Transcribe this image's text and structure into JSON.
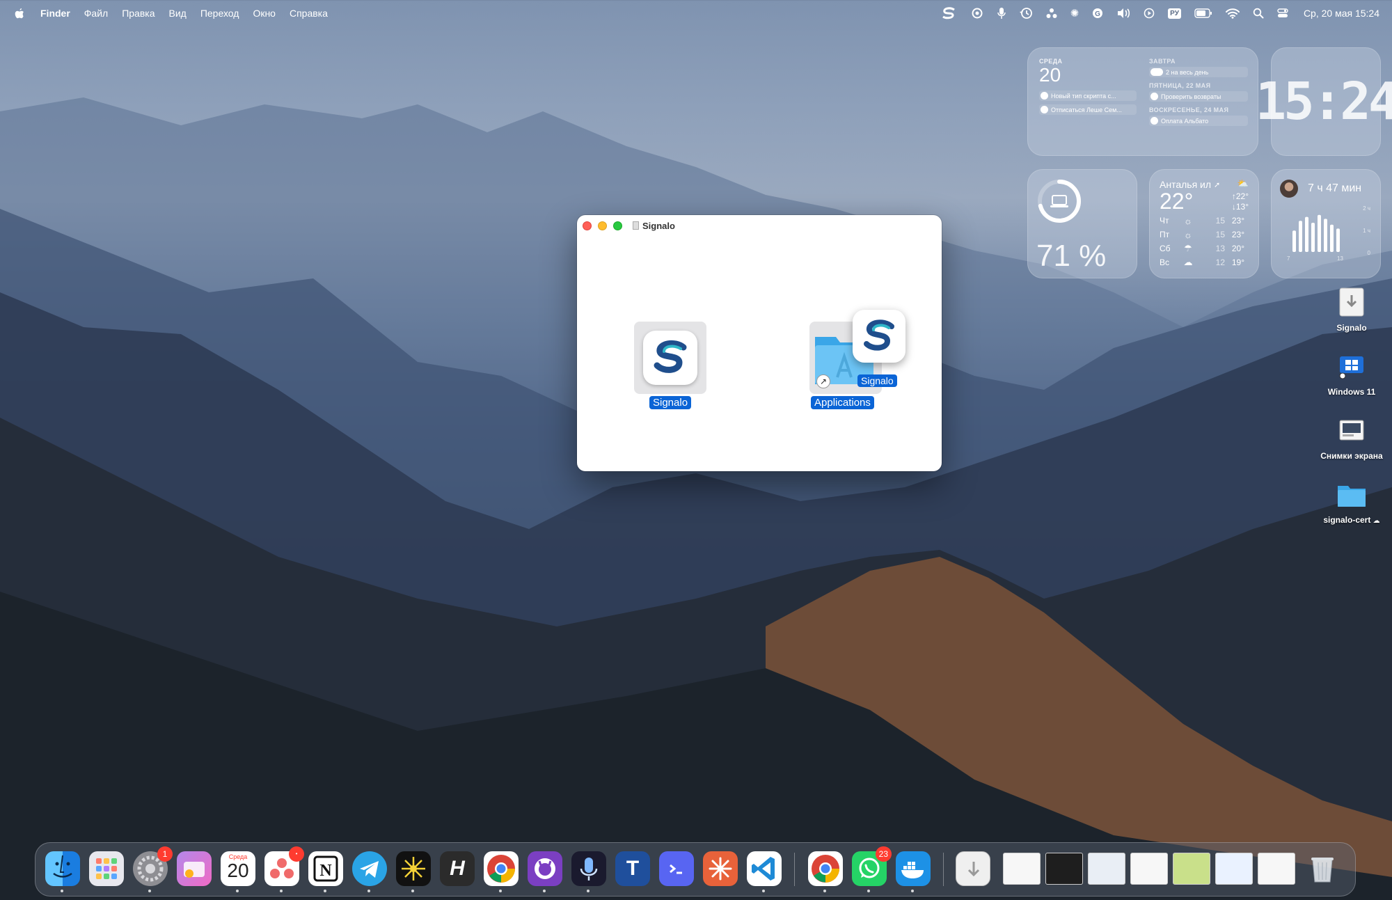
{
  "menubar": {
    "apple": "apple-icon",
    "app_name": "Finder",
    "menus": [
      "Файл",
      "Правка",
      "Вид",
      "Переход",
      "Окно",
      "Справка"
    ],
    "status_icons": [
      "signalo-icon",
      "creative-cloud-icon",
      "microphone-icon",
      "time-machine-icon",
      "connections-icon",
      "brightness-icon",
      "grammarly-icon",
      "volume-icon",
      "play-icon",
      "battery-icon",
      "wifi-icon",
      "search-icon",
      "control-center-icon"
    ],
    "keyboard_layout": "РУ",
    "datetime": "Ср, 20 мая  15:24"
  },
  "widgets": {
    "calendar": {
      "today_label": "СРЕДА",
      "today_day": "20",
      "today_events": [
        "Новый тип скрипта с...",
        "Отписаться Леше Сем..."
      ],
      "tomorrow_label": "ЗАВТРА",
      "tomorrow_event": "2 на весь день",
      "friday_label": "ПЯТНИЦА, 22 МАЯ",
      "friday_event": "Проверить возвраты",
      "sunday_label": "ВОСКРЕСЕНЬЕ, 24 МАЯ",
      "sunday_event": "Оплата Альбато"
    },
    "clock": {
      "time": "15:24"
    },
    "battery": {
      "percent": "71 %",
      "level": 0.71
    },
    "weather": {
      "city": "Анталья ил",
      "temp": "22°",
      "high": "↑22°",
      "low": "↓13°",
      "forecast": [
        {
          "day": "Чт",
          "icon": "sun-icon",
          "lo": "15",
          "hi": "23°"
        },
        {
          "day": "Пт",
          "icon": "sun-icon",
          "lo": "15",
          "hi": "23°"
        },
        {
          "day": "Сб",
          "icon": "rain-icon",
          "lo": "13",
          "hi": "20°"
        },
        {
          "day": "Вс",
          "icon": "cloud-icon",
          "lo": "12",
          "hi": "19°"
        }
      ]
    },
    "screentime": {
      "duration": "7 ч 47 мин",
      "scale": [
        "2 ч",
        "1 ч",
        "0"
      ],
      "x_labels": [
        "7",
        "13"
      ],
      "bars": [
        0.55,
        0.8,
        0.9,
        0.75,
        0.95,
        0.85,
        0.7,
        0.6
      ]
    }
  },
  "desktop": {
    "icons": [
      {
        "label": "Signalo",
        "icon": "disk-image-icon"
      },
      {
        "label": "Windows 11",
        "icon": "parallels-vm-icon"
      },
      {
        "label": "Снимки экрана",
        "icon": "screenshots-folder-icon"
      },
      {
        "label": "signalo-cert",
        "icon": "folder-icon"
      }
    ]
  },
  "finder_window": {
    "title": "Signalo",
    "app_label": "Signalo",
    "folder_label": "Applications",
    "drag_label": "Signalo"
  },
  "dock": {
    "apps": [
      {
        "name": "Finder",
        "icon": "finder-icon",
        "color": "#1e88e5"
      },
      {
        "name": "Launchpad",
        "icon": "launchpad-icon",
        "color": "#e8e8ee"
      },
      {
        "name": "System Settings",
        "icon": "settings-icon",
        "color": "#8e8e93",
        "badge": "1"
      },
      {
        "name": "Wallet",
        "icon": "wallet-icon",
        "color": "#b388eb"
      },
      {
        "name": "Calendar",
        "icon": "calendar-icon",
        "color": "#ffffff",
        "cal_month": "Среда",
        "cal_day": "20"
      },
      {
        "name": "Asana",
        "icon": "asana-icon",
        "color": "#ffffff",
        "badge": "•"
      },
      {
        "name": "Notion",
        "icon": "notion-icon",
        "color": "#ffffff"
      },
      {
        "name": "Telegram",
        "icon": "telegram-icon",
        "color": "#2aa4e6"
      },
      {
        "name": "Perplexity",
        "icon": "spark-icon",
        "color": "#111111"
      },
      {
        "name": "Hand Mirror",
        "icon": "h-icon",
        "color": "#2b2b2b"
      },
      {
        "name": "Chrome",
        "icon": "chrome-icon",
        "color": "#ffffff"
      },
      {
        "name": "GitHub Desktop",
        "icon": "github-icon",
        "color": "#7b3fc2"
      },
      {
        "name": "Voice",
        "icon": "microphone-icon",
        "color": "#1a1a2e"
      },
      {
        "name": "Typora",
        "icon": "t-icon",
        "color": "#1f4f9c"
      },
      {
        "name": "Terminal",
        "icon": "terminal-icon",
        "color": "#5865f2"
      },
      {
        "name": "Claude",
        "icon": "claude-icon",
        "color": "#e8623a"
      },
      {
        "name": "VS Code",
        "icon": "vscode-icon",
        "color": "#ffffff"
      },
      {
        "name": "Chrome",
        "icon": "chrome-icon",
        "color": "#ffffff"
      },
      {
        "name": "WhatsApp",
        "icon": "whatsapp-icon",
        "color": "#25d366",
        "badge": "23"
      },
      {
        "name": "Docker",
        "icon": "docker-icon",
        "color": "#1d91e6"
      }
    ],
    "trash": "trash-icon"
  }
}
